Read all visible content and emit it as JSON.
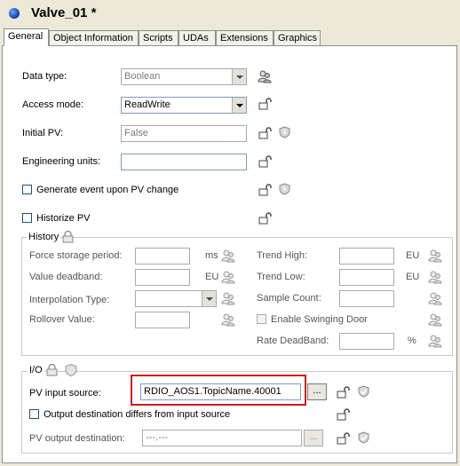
{
  "window": {
    "title": "Valve_01 *"
  },
  "tabs": [
    "General",
    "Object Information",
    "Scripts",
    "UDAs",
    "Extensions",
    "Graphics"
  ],
  "general": {
    "data_type": {
      "label": "Data type:",
      "value": "Boolean"
    },
    "access_mode": {
      "label": "Access mode:",
      "value": "ReadWrite"
    },
    "initial_pv": {
      "label": "Initial PV:",
      "value": "False"
    },
    "engineering_units": {
      "label": "Engineering units:",
      "value": ""
    },
    "generate_event": {
      "label": "Generate event upon PV change",
      "checked": false
    },
    "historize_pv": {
      "label": "Historize PV",
      "checked": false
    }
  },
  "history": {
    "title": "History",
    "force_storage_period": {
      "label": "Force storage period:",
      "unit": "ms"
    },
    "value_deadband": {
      "label": "Value deadband:",
      "unit": "EU"
    },
    "interpolation_type": {
      "label": "Interpolation Type:"
    },
    "rollover_value": {
      "label": "Rollover Value:"
    },
    "trend_high": {
      "label": "Trend High:",
      "unit": "EU"
    },
    "trend_low": {
      "label": "Trend Low:",
      "unit": "EU"
    },
    "sample_count": {
      "label": "Sample Count:"
    },
    "enable_swinging_door": {
      "label": "Enable Swinging Door",
      "checked": false
    },
    "rate_deadband": {
      "label": "Rate DeadBand:",
      "unit": "%"
    }
  },
  "io": {
    "title": "I/O",
    "pv_input_source": {
      "label": "PV input source:",
      "value": "RDIO_AOS1.TopicName.40001"
    },
    "output_differs": {
      "label": "Output destination differs from input source",
      "checked": false
    },
    "pv_output_destination": {
      "label": "PV output destination:",
      "value": "---.---"
    },
    "ellipsis_label": "..."
  }
}
